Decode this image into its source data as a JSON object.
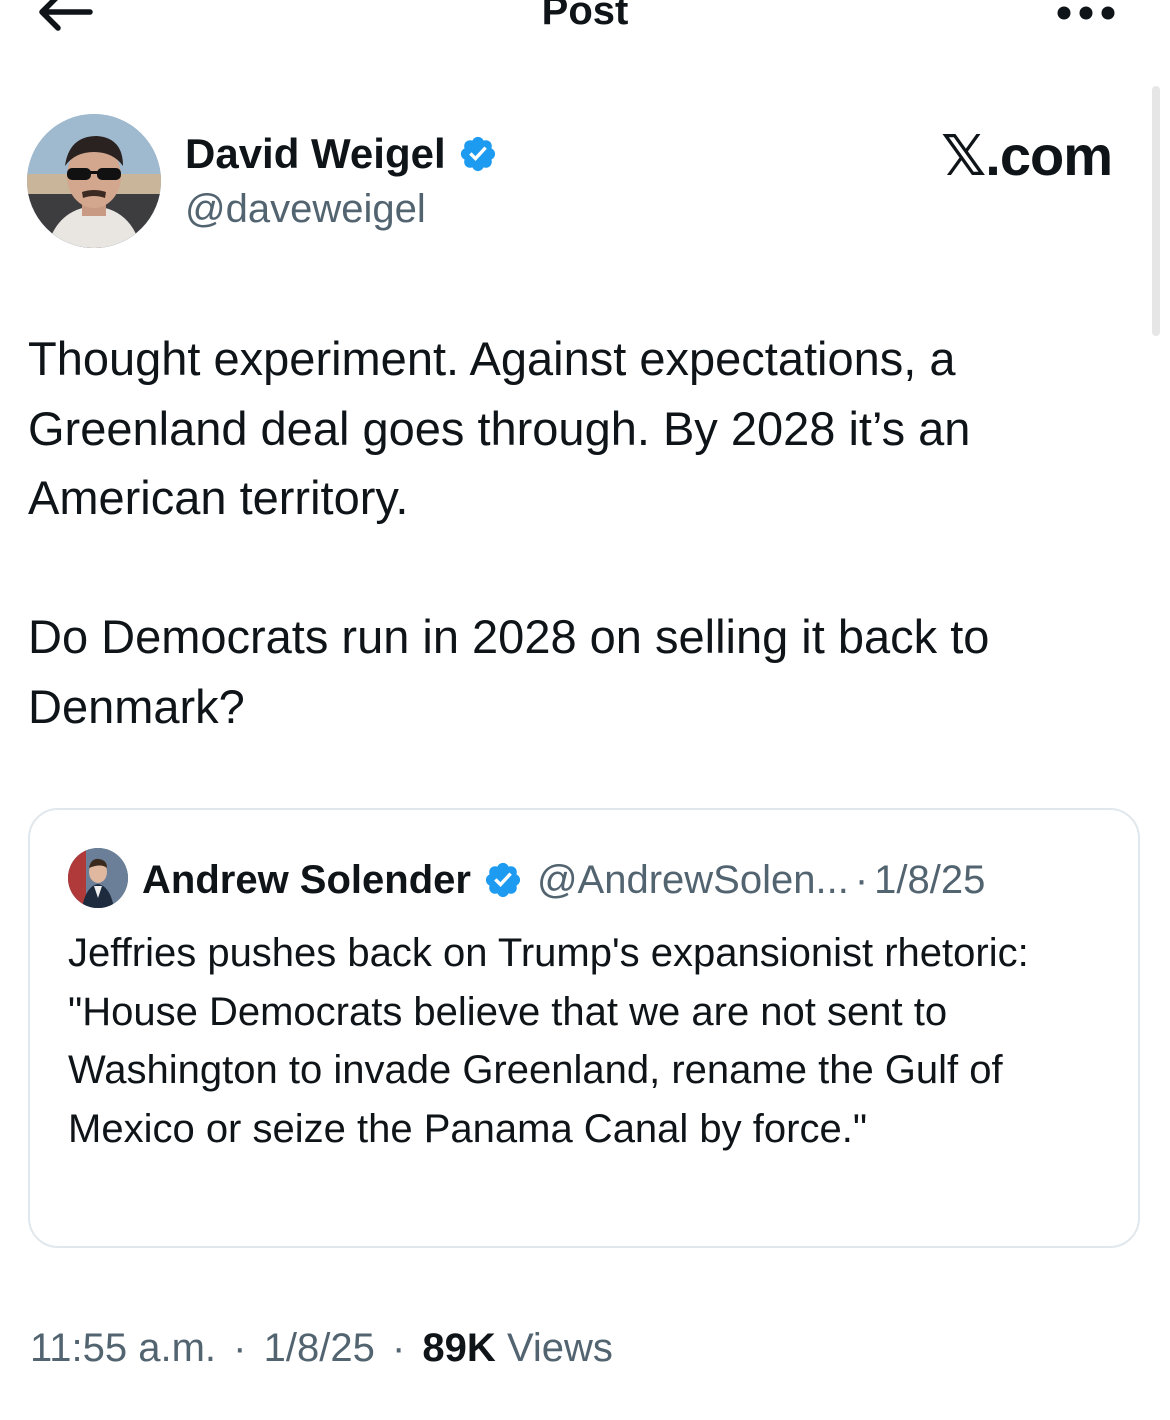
{
  "header": {
    "title": "Post",
    "back_icon": "arrow-left-icon",
    "more_icon": "more-horizontal-icon"
  },
  "author": {
    "name": "David Weigel",
    "handle": "@daveweigel",
    "verified_icon": "verified-badge-icon",
    "avatar": "avatar-photo"
  },
  "brand": "𝕏.com",
  "post": {
    "paragraphs": [
      "Thought experiment. Against expectations, a Greenland deal goes through. By 2028 it’s an American territory.",
      "Do Democrats run in 2028 on selling it back to Denmark?"
    ]
  },
  "quote": {
    "name": "Andrew Solender",
    "handle": "@AndrewSolen...",
    "separator": "·",
    "date": "1/8/25",
    "text": "Jeffries pushes back on Trump's expansionist rhetoric: \"House Democrats believe that we are not sent to Washington to invade Greenland, rename the Gulf of Mexico or seize the Panama Canal by force.\""
  },
  "footer": {
    "time": "11:55 a.m.",
    "separator": "·",
    "date": "1/8/25",
    "views_count": "89K",
    "views_label": "Views"
  },
  "colors": {
    "text": "#0f1419",
    "secondary": "#536471",
    "verified": "#1d9bf0",
    "border": "#e1e8ed"
  }
}
